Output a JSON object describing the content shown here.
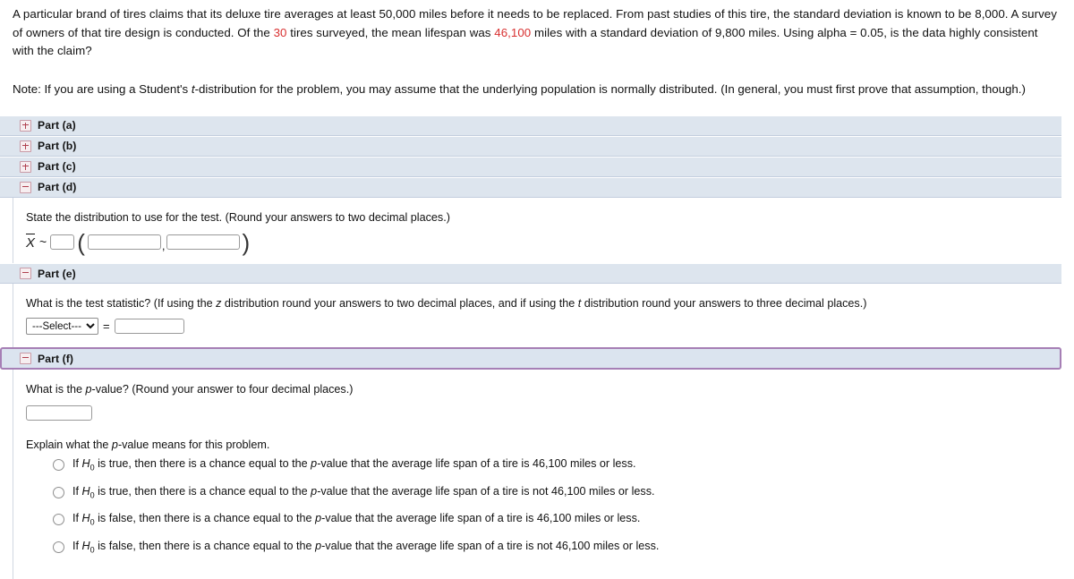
{
  "problem": {
    "text_before_n": "A particular brand of tires claims that its deluxe tire averages at least 50,000 miles before it needs to be replaced. From past studies of this tire, the standard deviation is known to be 8,000. A survey of owners of that tire design is conducted. Of the ",
    "n_value": "30",
    "text_mid": " tires surveyed, the mean lifespan was ",
    "mean_value": "46,100",
    "text_after": " miles with a standard deviation of 9,800 miles. Using alpha = 0.05, is the data highly consistent with the claim?",
    "note_prefix": "Note: If you are using a Student's ",
    "note_italic": "t",
    "note_suffix": "-distribution for the problem, you may assume that the underlying population is normally distributed. (In general, you must first prove that assumption, though.)"
  },
  "parts": [
    {
      "label": "Part (a)",
      "state": "collapsed",
      "icon": "plus-icon"
    },
    {
      "label": "Part (b)",
      "state": "collapsed",
      "icon": "plus-icon"
    },
    {
      "label": "Part (c)",
      "state": "collapsed",
      "icon": "plus-icon"
    },
    {
      "label": "Part (d)",
      "state": "expanded",
      "icon": "minus-icon"
    },
    {
      "label": "Part (e)",
      "state": "expanded",
      "icon": "minus-icon"
    },
    {
      "label": "Part (f)",
      "state": "expanded",
      "icon": "minus-icon",
      "focused": true
    }
  ],
  "part_d": {
    "question": "State the distribution to use for the test. (Round your answers to two decimal places.)",
    "xbar_symbol": "X",
    "tilde": "~",
    "open_paren": "(",
    "comma": ",",
    "close_paren": ")",
    "dist_name_value": "",
    "param1_value": "",
    "param2_value": ""
  },
  "part_e": {
    "question_part1": "What is the test statistic? (If using the ",
    "question_z": "z",
    "question_part2": " distribution round your answers to two decimal places, and if using the ",
    "question_t": "t",
    "question_part3": " distribution round your answers to three decimal places.)",
    "select_value": "---Select---",
    "select_options": [
      "---Select---"
    ],
    "equals": "=",
    "statistic_value": ""
  },
  "part_f": {
    "question_prefix": "What is the ",
    "question_p": "p",
    "question_suffix": "-value? (Round your answer to four decimal places.)",
    "pvalue_input": "",
    "explain_prefix": "Explain what the ",
    "explain_p": "p",
    "explain_suffix": "-value means for this problem.",
    "options": [
      {
        "pre_h0": "If ",
        "h0": "H",
        "h0_sub": "0",
        "post": " is true, then there is a chance equal to the ",
        "p": "p",
        "post2": "-value that the average life span of a tire is 46,100 miles or less.",
        "selected": false
      },
      {
        "pre_h0": "If ",
        "h0": "H",
        "h0_sub": "0",
        "post": " is true, then there is a chance equal to the ",
        "p": "p",
        "post2": "-value that the average life span of a tire is not 46,100 miles or less.",
        "selected": false
      },
      {
        "pre_h0": "If ",
        "h0": "H",
        "h0_sub": "0",
        "post": " is false, then there is a chance equal to the ",
        "p": "p",
        "post2": "-value that the average life span of a tire is 46,100 miles or less.",
        "selected": false
      },
      {
        "pre_h0": "If ",
        "h0": "H",
        "h0_sub": "0",
        "post": " is false, then there is a chance equal to the ",
        "p": "p",
        "post2": "-value that the average life span of a tire is not 46,100 miles or less.",
        "selected": false
      }
    ]
  },
  "colors": {
    "header_bg": "#dde5ee",
    "highlight_red": "#d83030",
    "focus_border": "#a67fb5",
    "icon_border": "#c99aa6"
  }
}
